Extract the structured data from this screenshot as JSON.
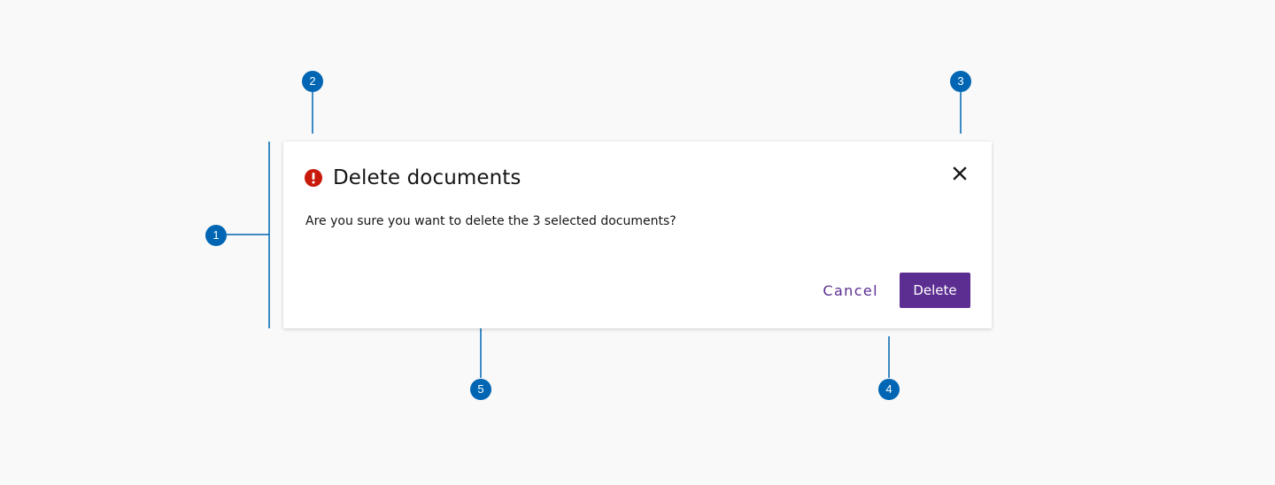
{
  "dialog": {
    "title": "Delete documents",
    "message": "Are you sure you want to delete the 3 selected documents?",
    "cancel_label": "Cancel",
    "delete_label": "Delete",
    "title_icon": "alert-icon",
    "close_icon": "close-icon"
  },
  "annotations": [
    {
      "label": "1"
    },
    {
      "label": "2"
    },
    {
      "label": "3"
    },
    {
      "label": "4"
    },
    {
      "label": "5"
    }
  ],
  "colors": {
    "background": "#f9f9f9",
    "dialog_background": "#ffffff",
    "annotation": "#0066b3",
    "primary": "#5c2e91",
    "danger": "#c9190b",
    "text": "#151515"
  }
}
